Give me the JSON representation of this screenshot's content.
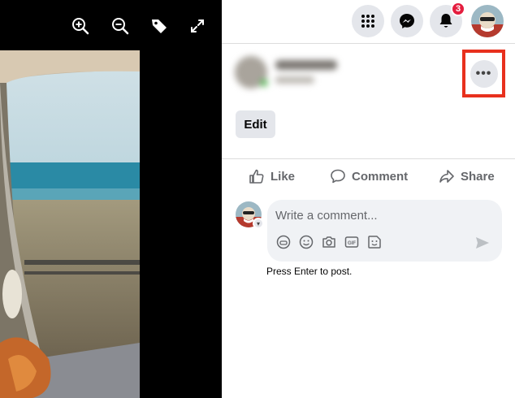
{
  "viewer": {
    "tools": [
      {
        "icon": "zoom-in-icon"
      },
      {
        "icon": "zoom-out-icon"
      },
      {
        "icon": "tag-icon"
      },
      {
        "icon": "fullscreen-icon"
      }
    ]
  },
  "topbar": {
    "menu_icon": "grid-menu-icon",
    "messenger_icon": "messenger-icon",
    "notifications_icon": "bell-icon",
    "notifications_count": "3"
  },
  "post": {
    "more_label": "•••",
    "edit_label": "Edit"
  },
  "actions": {
    "like": "Like",
    "comment": "Comment",
    "share": "Share"
  },
  "composer": {
    "placeholder": "Write a comment...",
    "hint": "Press Enter to post."
  },
  "colors": {
    "highlight": "#e8301d",
    "badge": "#e41e3f",
    "button_bg": "#e4e6eb",
    "muted_text": "#65676b"
  }
}
